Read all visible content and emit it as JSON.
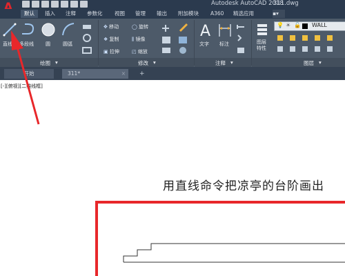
{
  "app": {
    "logo": "A",
    "window_title": "Autodesk AutoCAD 2018",
    "file_name": "311.dwg"
  },
  "tabs": [
    "默认",
    "插入",
    "注释",
    "参数化",
    "视图",
    "管理",
    "输出",
    "附加模块",
    "A360",
    "精选应用"
  ],
  "ribbon": {
    "draw": {
      "line": "直线",
      "polyline": "多段线",
      "circle": "圆",
      "arc": "圆弧",
      "panel": "绘图"
    },
    "modify": {
      "move": "移动",
      "rotate": "旋转",
      "copy": "复制",
      "mirror": "镜像",
      "stretch": "拉伸",
      "scale": "缩放",
      "panel": "修改"
    },
    "annotation": {
      "text": "文字",
      "dimension": "标注",
      "panel": "注释"
    },
    "layers": {
      "props": "图层\n特性",
      "current_layer": "WALL",
      "panel": "图层"
    }
  },
  "file_tabs": {
    "start": "开始",
    "drawing": "311*",
    "new": "+"
  },
  "viewport_label": "[-][俯视][二维线框]",
  "caption": "用直线命令把凉亭的台阶画出",
  "colors": {
    "highlight_red": "#e8272a",
    "ribbon": "#4d5a69",
    "titlebar": "#2b3a4e"
  }
}
